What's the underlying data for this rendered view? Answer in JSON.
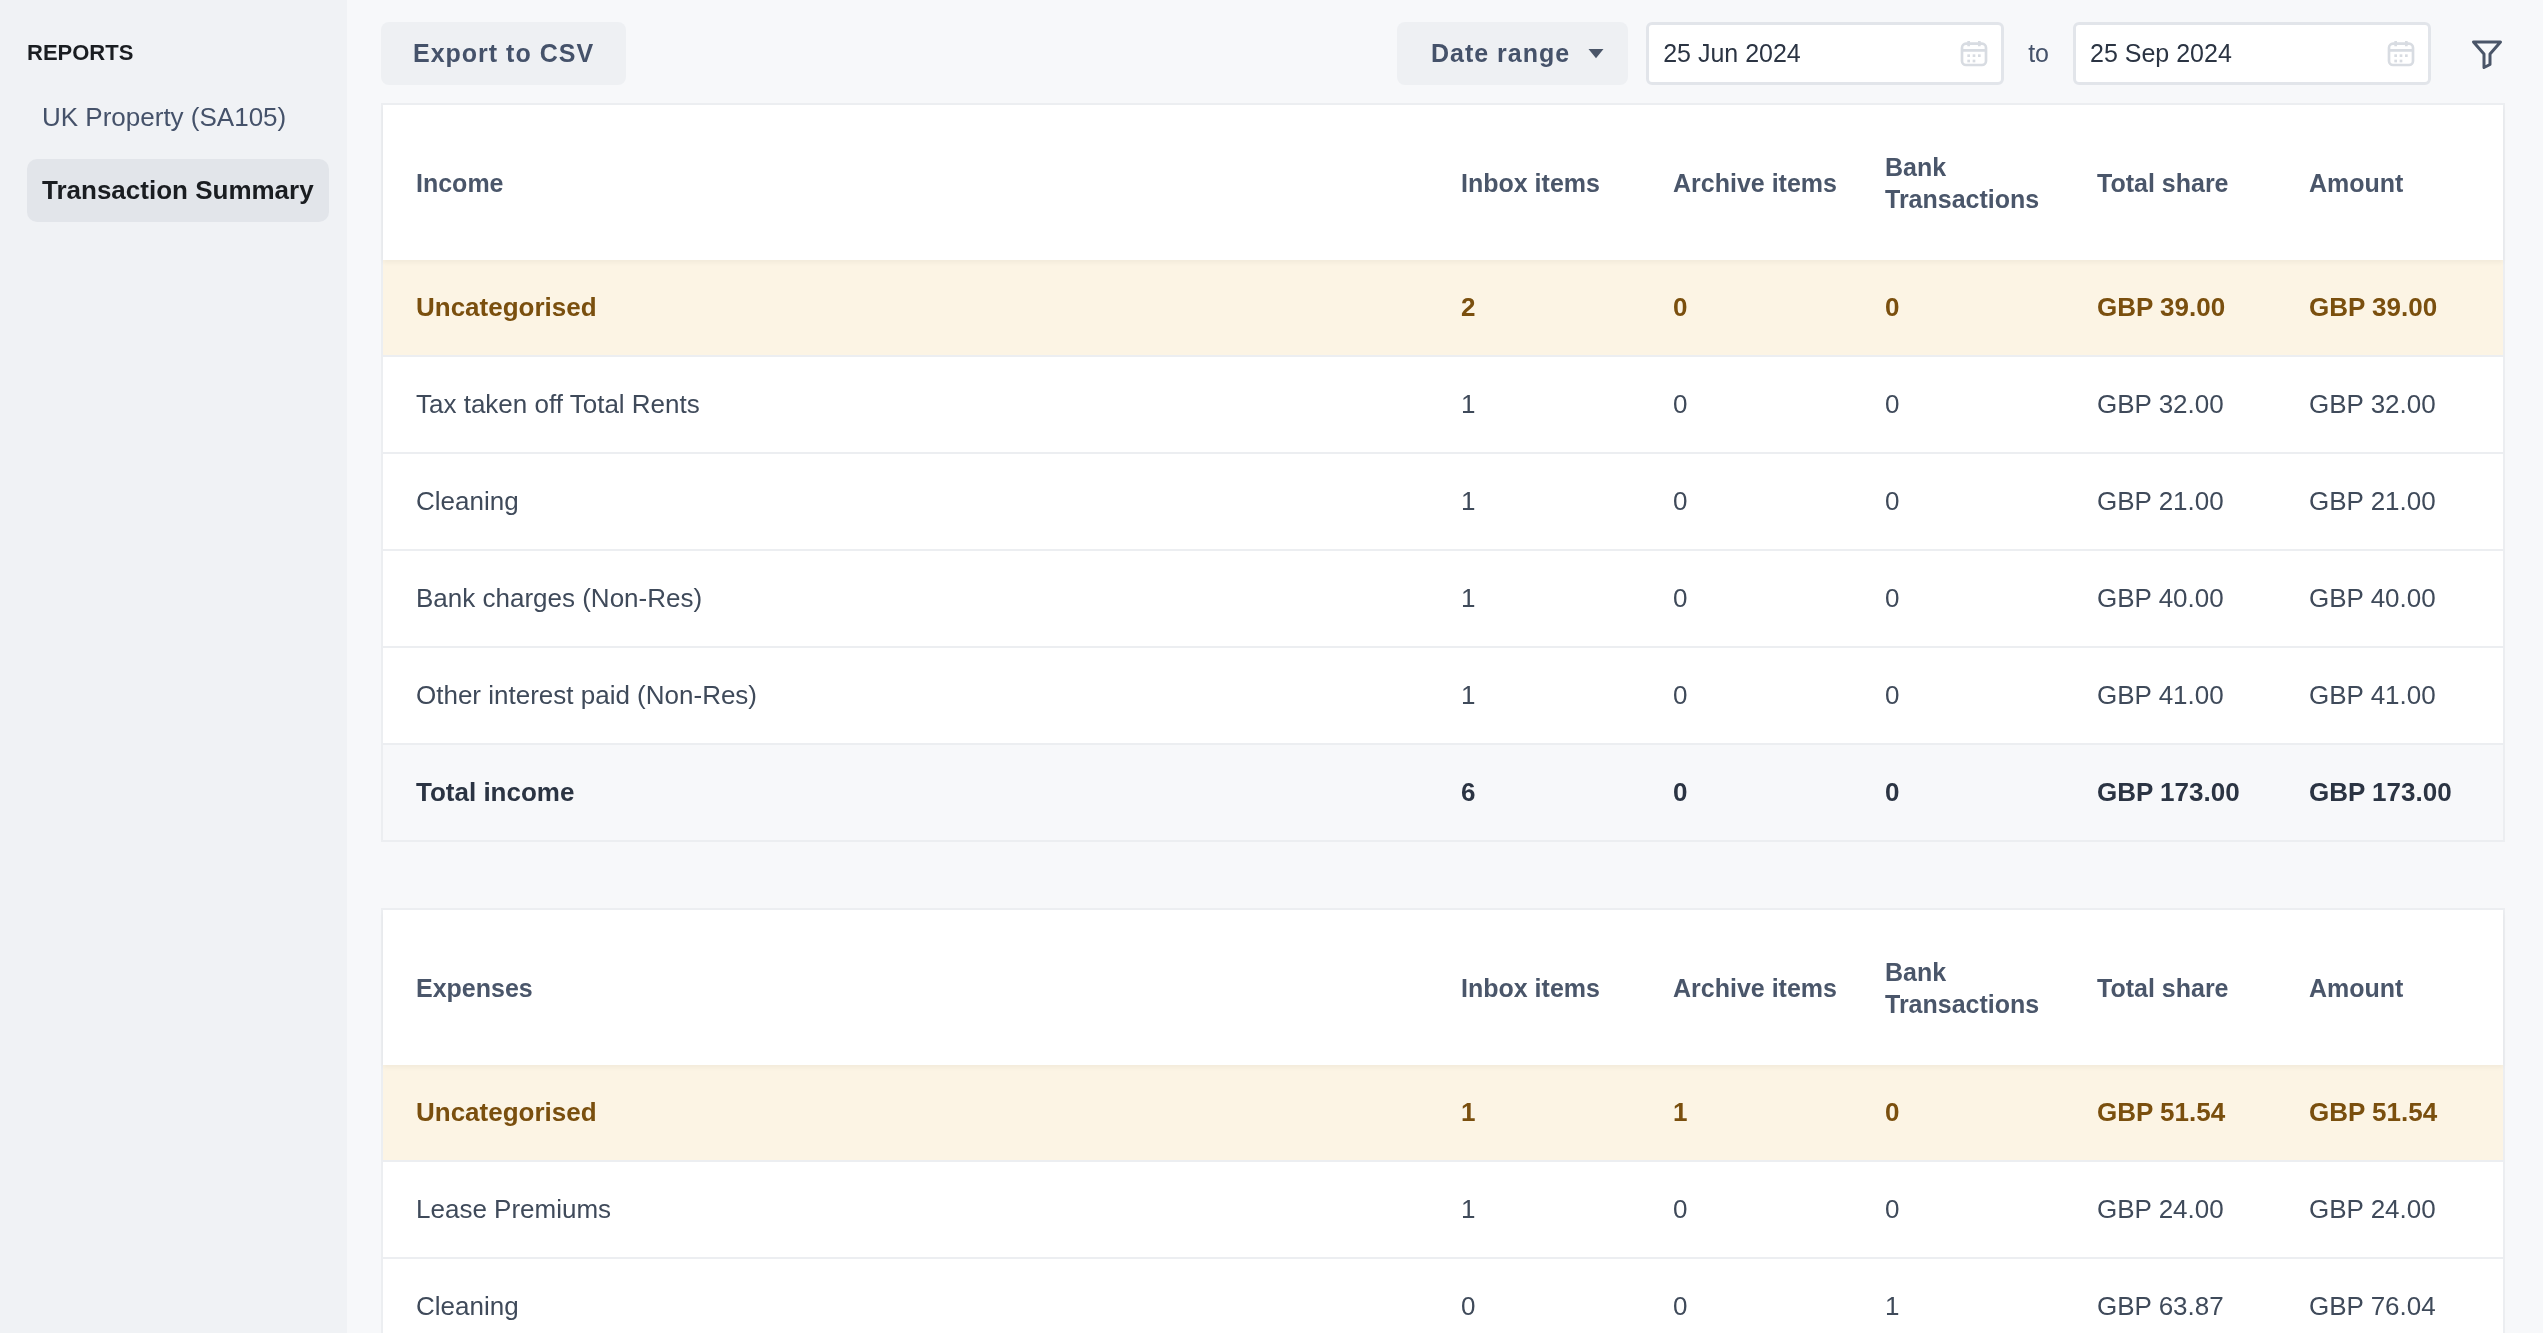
{
  "sidebar": {
    "heading": "REPORTS",
    "items": [
      {
        "label": "UK Property (SA105)",
        "selected": false
      },
      {
        "label": "Transaction Summary",
        "selected": true
      }
    ]
  },
  "toolbar": {
    "export_button": "Export to CSV",
    "date_range_button": "Date range",
    "date_from": {
      "value": "25 Jun 2024"
    },
    "separator": "to",
    "date_to": {
      "value": "25 Sep 2024"
    }
  },
  "tables": [
    {
      "columns": [
        "Income",
        "Inbox items",
        "Archive items",
        "Bank Transactions",
        "Total share",
        "Amount"
      ],
      "rows": [
        {
          "kind": "uncategorised",
          "cells": [
            "Uncategorised",
            "2",
            "0",
            "0",
            "GBP 39.00",
            "GBP 39.00"
          ]
        },
        {
          "kind": "normal",
          "cells": [
            "Tax taken off Total Rents",
            "1",
            "0",
            "0",
            "GBP 32.00",
            "GBP 32.00"
          ]
        },
        {
          "kind": "normal",
          "cells": [
            "Cleaning",
            "1",
            "0",
            "0",
            "GBP 21.00",
            "GBP 21.00"
          ]
        },
        {
          "kind": "normal",
          "cells": [
            "Bank charges (Non-Res)",
            "1",
            "0",
            "0",
            "GBP 40.00",
            "GBP 40.00"
          ]
        },
        {
          "kind": "normal",
          "cells": [
            "Other interest paid (Non-Res)",
            "1",
            "0",
            "0",
            "GBP 41.00",
            "GBP 41.00"
          ]
        },
        {
          "kind": "total",
          "cells": [
            "Total income",
            "6",
            "0",
            "0",
            "GBP 173.00",
            "GBP 173.00"
          ]
        }
      ]
    },
    {
      "columns": [
        "Expenses",
        "Inbox items",
        "Archive items",
        "Bank Transactions",
        "Total share",
        "Amount"
      ],
      "rows": [
        {
          "kind": "uncategorised",
          "cells": [
            "Uncategorised",
            "1",
            "1",
            "0",
            "GBP 51.54",
            "GBP 51.54"
          ]
        },
        {
          "kind": "normal",
          "cells": [
            "Lease Premiums",
            "1",
            "0",
            "0",
            "GBP 24.00",
            "GBP 24.00"
          ]
        },
        {
          "kind": "normal",
          "cells": [
            "Cleaning",
            "0",
            "0",
            "1",
            "GBP 63.87",
            "GBP 76.04"
          ]
        }
      ]
    }
  ]
}
